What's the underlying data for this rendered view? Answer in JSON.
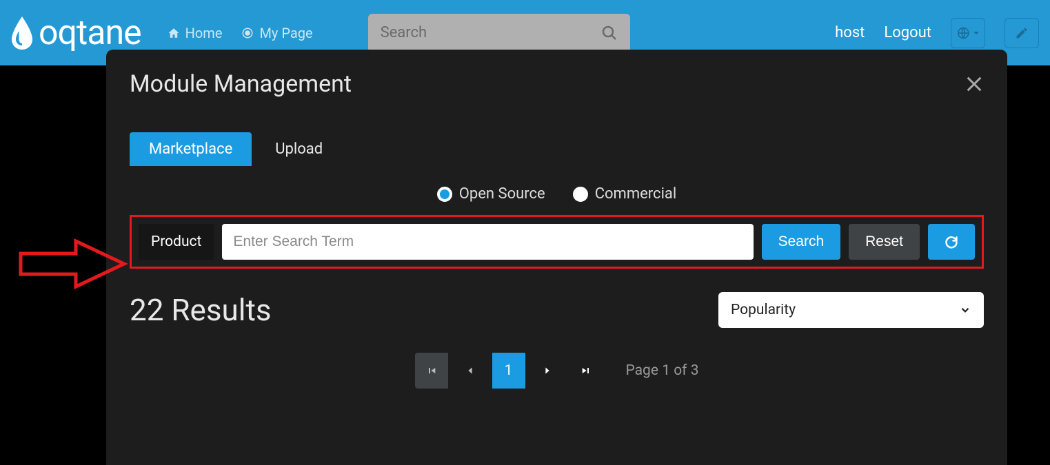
{
  "topbar": {
    "logo_text": "oqtane",
    "nav": {
      "home": "Home",
      "my_page": "My Page"
    },
    "search_placeholder": "Search",
    "user": "host",
    "logout": "Logout"
  },
  "modal": {
    "title": "Module Management",
    "tabs": {
      "marketplace": "Marketplace",
      "upload": "Upload"
    },
    "filters": {
      "open_source": "Open Source",
      "commercial": "Commercial"
    },
    "product_label": "Product",
    "product_placeholder": "Enter Search Term",
    "buttons": {
      "search": "Search",
      "reset": "Reset"
    },
    "results": {
      "count": 22,
      "label": "Results",
      "text": "22 Results"
    },
    "sort": {
      "selected": "Popularity"
    },
    "pagination": {
      "current": "1",
      "info": "Page 1 of 3"
    }
  }
}
